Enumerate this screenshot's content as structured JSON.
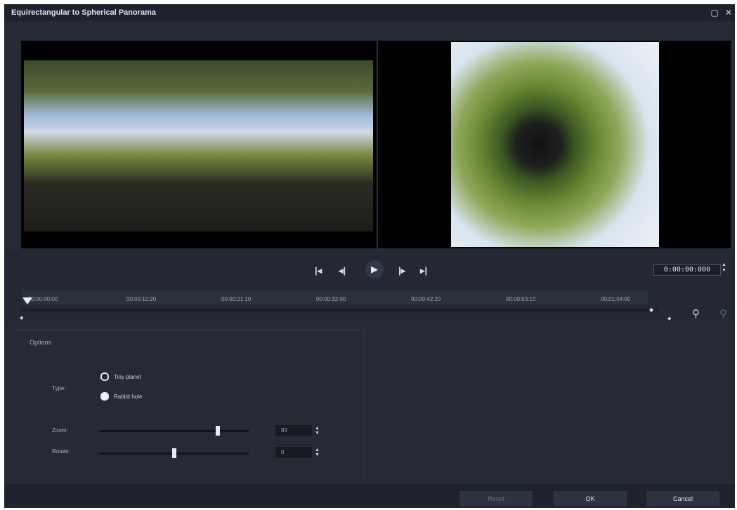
{
  "window": {
    "title": "Equirectangular to Spherical Panorama",
    "maximize_icon": "▢",
    "close_icon": "✕"
  },
  "playback": {
    "go_start": "|◂",
    "prev_frame": "◂|",
    "play": "▶",
    "next_frame": "|▸",
    "go_end": "▸|",
    "timecode": "0:00:00:000"
  },
  "timeline": {
    "ticks": [
      "00:00:00:00",
      "00:00:10:20",
      "00:00:21:10",
      "00:00:32:00",
      "00:00:42:20",
      "00:00:53:10",
      "00:01:04:00"
    ],
    "zoom_in_icon": "zoom-in-icon",
    "zoom_out_icon": "zoom-out-icon"
  },
  "options": {
    "section_label": "Options",
    "type_label": "Type:",
    "type_options": [
      "Tiny planet",
      "Rabbit hole"
    ],
    "type_selected": "Rabbit hole",
    "zoom_label": "Zoom:",
    "zoom_value": "83",
    "rotate_label": "Rotate:",
    "rotate_value": "0",
    "zoom_slider_fraction": 0.8,
    "rotate_slider_fraction": 0.5
  },
  "buttons": {
    "reset": "Reset",
    "ok": "OK",
    "cancel": "Cancel"
  }
}
